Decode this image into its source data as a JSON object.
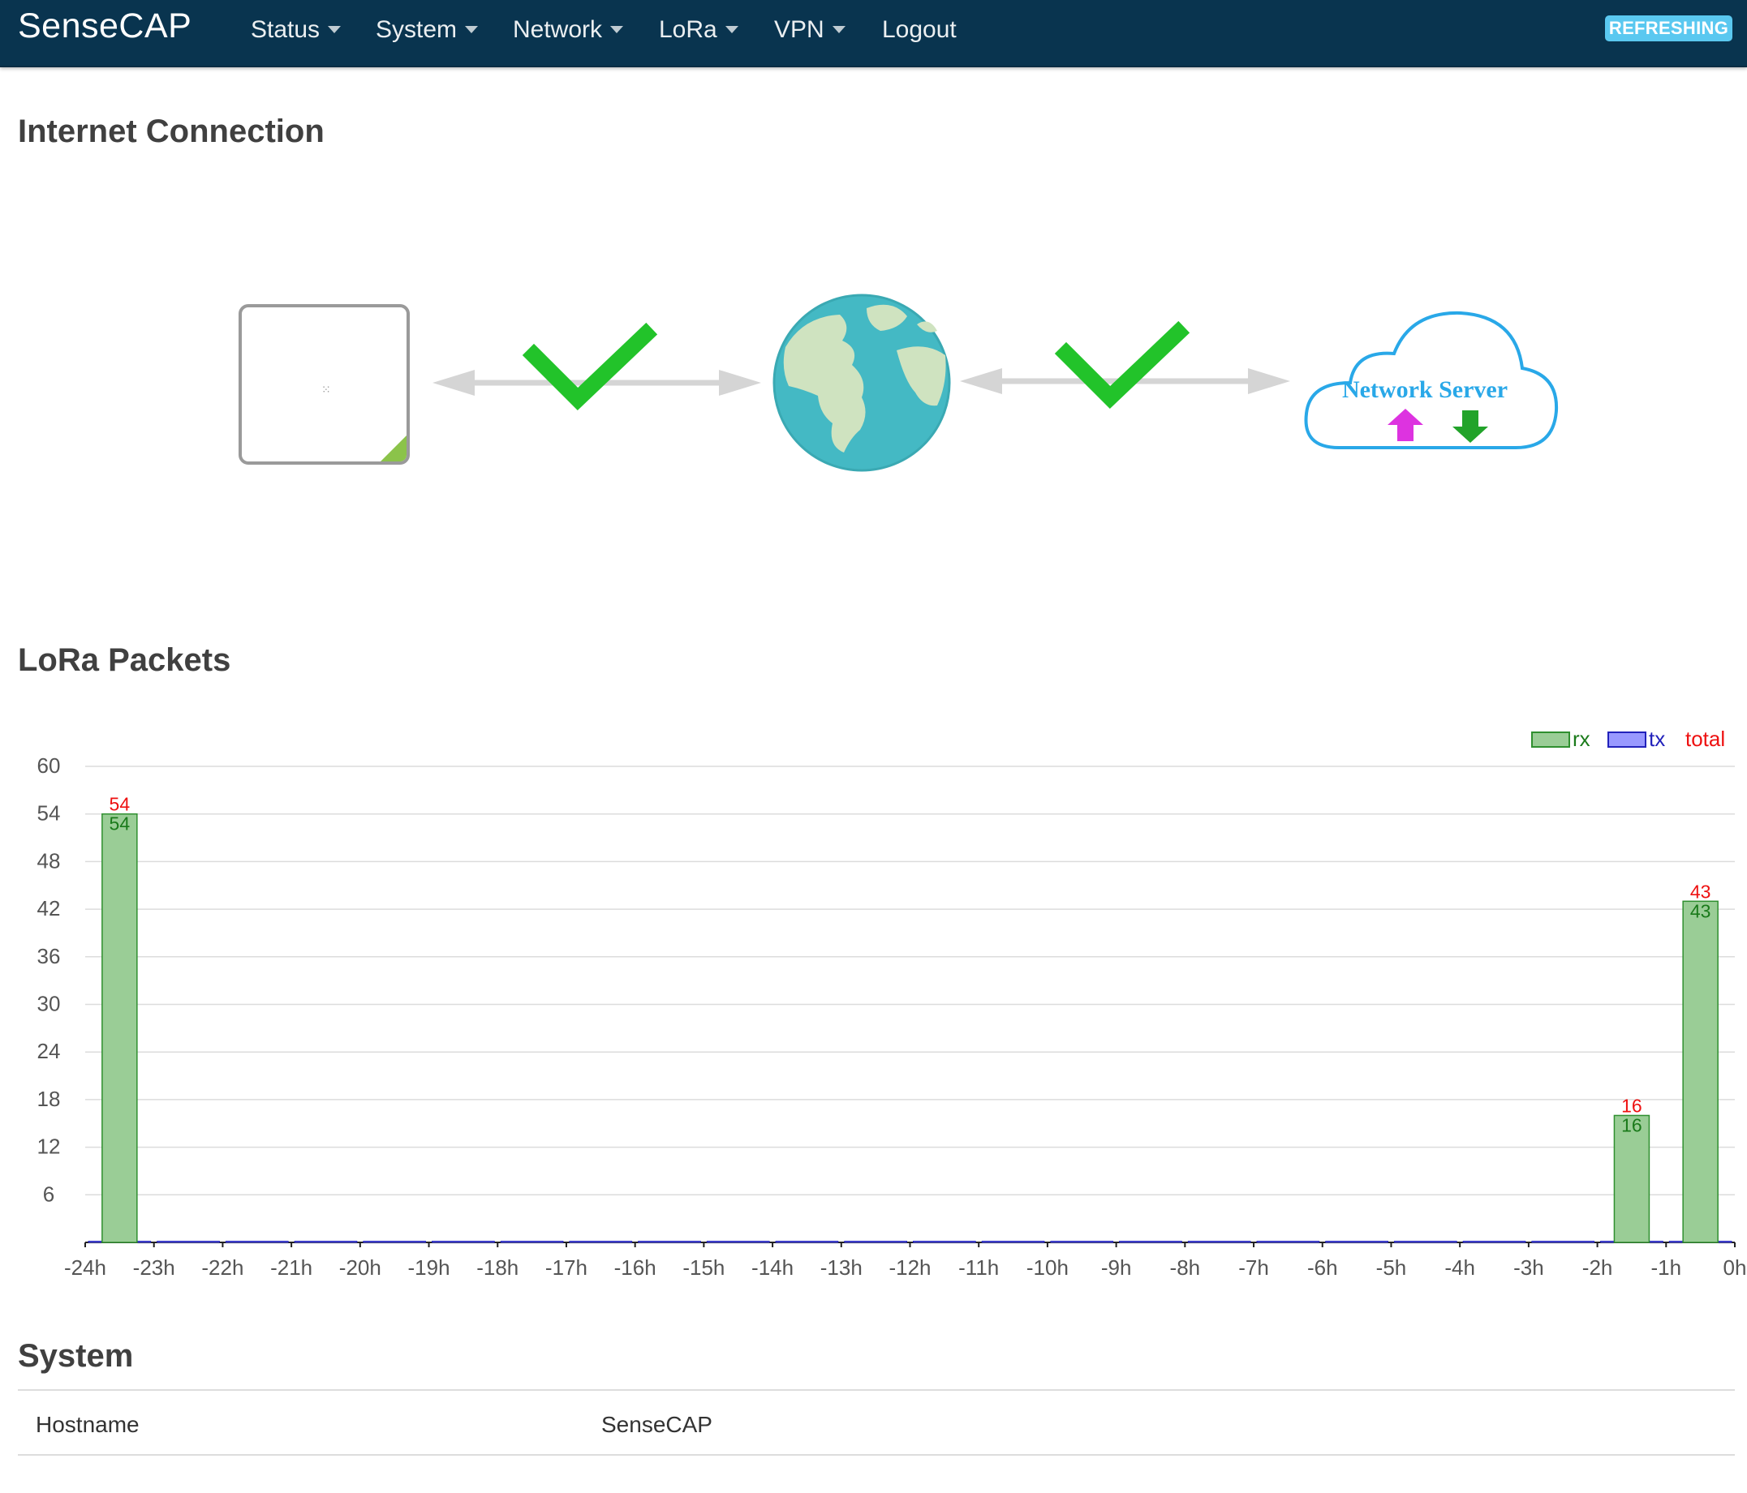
{
  "navbar": {
    "brand": "SenseCAP",
    "menu": [
      {
        "label": "Status",
        "dropdown": true
      },
      {
        "label": "System",
        "dropdown": true
      },
      {
        "label": "Network",
        "dropdown": true
      },
      {
        "label": "LoRa",
        "dropdown": true
      },
      {
        "label": "VPN",
        "dropdown": true
      },
      {
        "label": "Logout",
        "dropdown": false
      }
    ],
    "badge": "REFRESHING"
  },
  "internet": {
    "title": "Internet Connection",
    "device_dots": "⁙",
    "server_label": "Network Server",
    "link1_status": "ok",
    "link2_status": "ok",
    "colors": {
      "check": "#22c32a",
      "arrow": "#d5d5d5",
      "globe_ocean": "#44b9c4",
      "globe_land": "#cfe3c0",
      "cloud": "#29a8e8",
      "up_arrow": "#dd33e0",
      "down_arrow": "#22a32a"
    }
  },
  "lora": {
    "title": "LoRa Packets"
  },
  "chart_data": {
    "type": "bar",
    "categories": [
      "-24h",
      "-23h",
      "-22h",
      "-21h",
      "-20h",
      "-19h",
      "-18h",
      "-17h",
      "-16h",
      "-15h",
      "-14h",
      "-13h",
      "-12h",
      "-11h",
      "-10h",
      "-9h",
      "-8h",
      "-7h",
      "-6h",
      "-5h",
      "-4h",
      "-3h",
      "-2h",
      "-1h",
      "0h"
    ],
    "bar_slots": [
      "-24h..-23h",
      "-23h..-22h",
      "-22h..-21h",
      "-21h..-20h",
      "-20h..-19h",
      "-19h..-18h",
      "-18h..-17h",
      "-17h..-16h",
      "-16h..-15h",
      "-15h..-14h",
      "-14h..-13h",
      "-13h..-12h",
      "-12h..-11h",
      "-11h..-10h",
      "-10h..-9h",
      "-9h..-8h",
      "-8h..-7h",
      "-7h..-6h",
      "-6h..-5h",
      "-5h..-4h",
      "-4h..-3h",
      "-3h..-2h",
      "-2h..-1h",
      "-1h..0h"
    ],
    "series": [
      {
        "name": "rx",
        "color": "#9acd96",
        "stroke": "#2f8f2f",
        "label_color": "#1a7a1a",
        "values": [
          54,
          0,
          0,
          0,
          0,
          0,
          0,
          0,
          0,
          0,
          0,
          0,
          0,
          0,
          0,
          0,
          0,
          0,
          0,
          0,
          0,
          0,
          16,
          43
        ]
      },
      {
        "name": "tx",
        "color": "#9999ff",
        "stroke": "#2222bb",
        "label_color": "#2222bb",
        "values": [
          0,
          0,
          0,
          0,
          0,
          0,
          0,
          0,
          0,
          0,
          0,
          0,
          0,
          0,
          0,
          0,
          0,
          0,
          0,
          0,
          0,
          0,
          0,
          0
        ]
      },
      {
        "name": "total",
        "color": "#ee1111",
        "label_color": "#ee1111",
        "values": [
          54,
          0,
          0,
          0,
          0,
          0,
          0,
          0,
          0,
          0,
          0,
          0,
          0,
          0,
          0,
          0,
          0,
          0,
          0,
          0,
          0,
          0,
          16,
          43
        ]
      }
    ],
    "yticks": [
      6,
      12,
      18,
      24,
      30,
      36,
      42,
      48,
      54,
      60
    ],
    "ylim": [
      0,
      60
    ],
    "grid": true,
    "legend": "top-right"
  },
  "system": {
    "title": "System",
    "rows": [
      {
        "label": "Hostname",
        "value": "SenseCAP"
      }
    ]
  }
}
